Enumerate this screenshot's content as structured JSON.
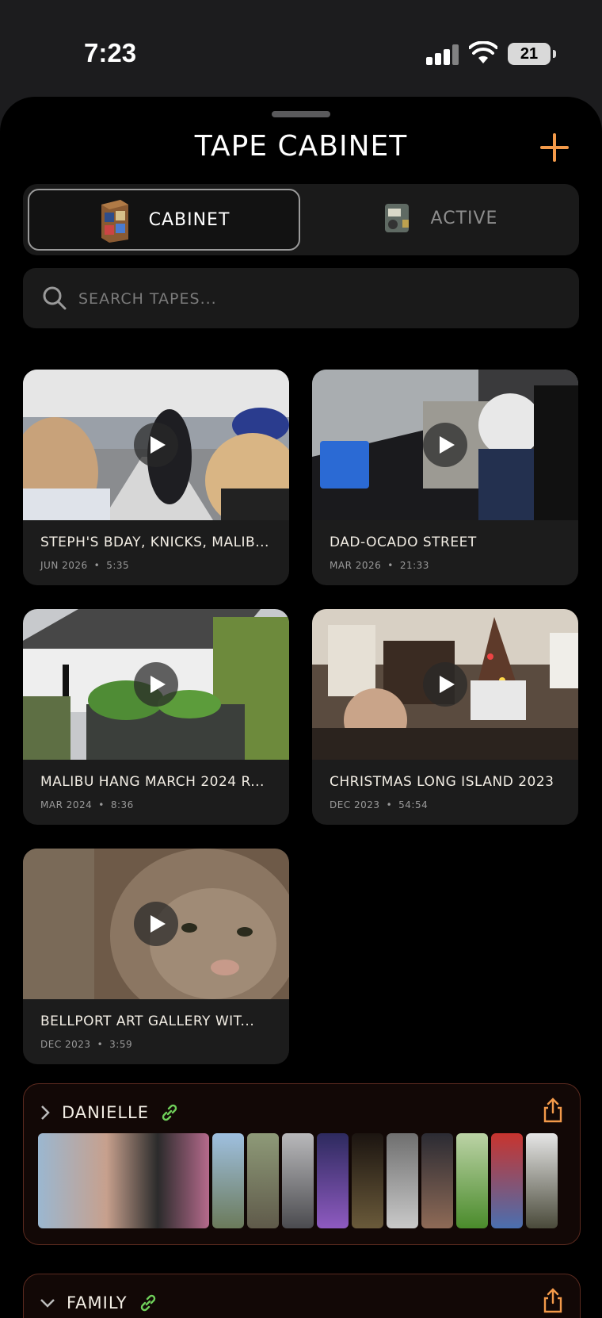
{
  "status_bar": {
    "time": "7:23",
    "battery": "21"
  },
  "header": {
    "title": "TAPE CABINET"
  },
  "segments": {
    "cabinet_label": "CABINET",
    "active_label": "ACTIVE"
  },
  "search": {
    "placeholder": "SEARCH TAPES..."
  },
  "tapes": [
    {
      "title": "STEPH'S BDAY, KNICKS, MALIB...",
      "date": "JUN 2026",
      "duration": "5:35"
    },
    {
      "title": "DAD-OCADO STREET",
      "date": "MAR 2026",
      "duration": "21:33"
    },
    {
      "title": "MALIBU HANG MARCH 2024 R...",
      "date": "MAR 2024",
      "duration": "8:36"
    },
    {
      "title": "CHRISTMAS LONG ISLAND 2023",
      "date": "DEC 2023",
      "duration": "54:54"
    },
    {
      "title": "BELLPORT ART GALLERY WIT...",
      "date": "DEC 2023",
      "duration": "3:59"
    }
  ],
  "folders": [
    {
      "name": "DANIELLE"
    },
    {
      "name": "FAMILY"
    }
  ],
  "colors": {
    "accent": "#f39a4a",
    "link": "#6fcf5a",
    "folder_border": "#5b2a1f"
  }
}
